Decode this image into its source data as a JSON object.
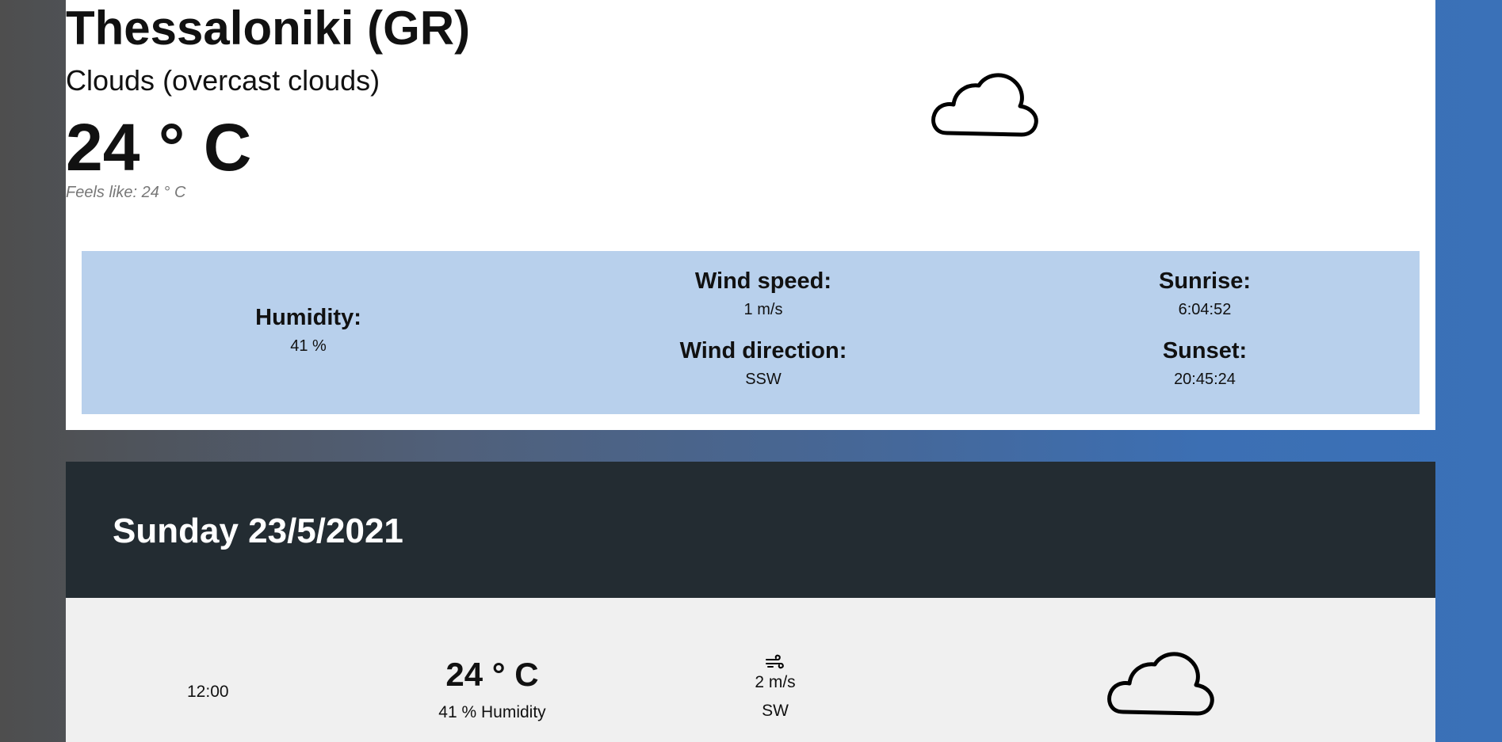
{
  "current": {
    "city": "Thessaloniki (GR)",
    "condition": "Clouds (overcast clouds)",
    "temperature": "24 ° C",
    "feels_like": "Feels like: 24 ° C",
    "icon": "cloud-icon"
  },
  "stats": {
    "humidity_label": "Humidity:",
    "humidity_value": "41 %",
    "wind_speed_label": "Wind speed:",
    "wind_speed_value": "1 m/s",
    "wind_direction_label": "Wind direction:",
    "wind_direction_value": "SSW",
    "sunrise_label": "Sunrise:",
    "sunrise_value": "6:04:52",
    "sunset_label": "Sunset:",
    "sunset_value": "20:45:24"
  },
  "forecast": {
    "day_title": "Sunday 23/5/2021",
    "rows": [
      {
        "time": "12:00",
        "temperature": "24 ° C",
        "humidity": "41 % Humidity",
        "wind_icon": "wind-icon",
        "wind_speed": "2 m/s",
        "wind_direction": "SW",
        "icon": "cloud-icon"
      }
    ]
  },
  "colors": {
    "card_background": "#ffffff",
    "stats_background": "#b8d0ec",
    "day_header_background": "#232c32",
    "forecast_row_background": "#f0f0f0",
    "page_gradient_end": "#3a71b8"
  }
}
